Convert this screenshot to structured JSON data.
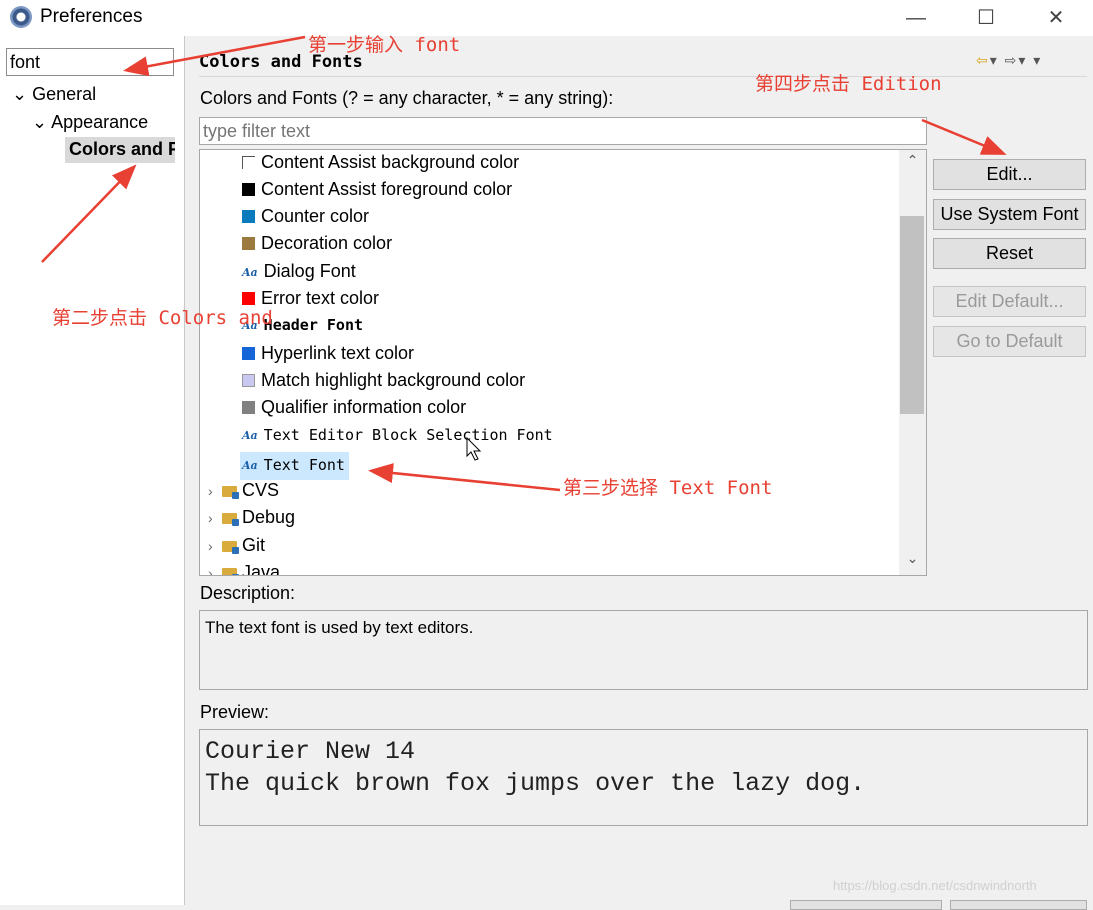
{
  "window": {
    "title": "Preferences",
    "controls": {
      "minimize": "—",
      "maximize": "☐",
      "close": "✕"
    }
  },
  "sidebar": {
    "filter_value": "font",
    "tree": {
      "general": "General",
      "appearance": "Appearance",
      "colors_and_fonts": "Colors and Fonts"
    }
  },
  "main": {
    "header": "Colors and Fonts",
    "list_label": "Colors and Fonts (? = any character, * = any string):",
    "filter_placeholder": "type filter text",
    "items": [
      {
        "label": "Content Assist background color",
        "icon": "swatch",
        "color": "#ffffff"
      },
      {
        "label": "Content Assist foreground color",
        "icon": "swatch",
        "color": "#000000"
      },
      {
        "label": "Counter color",
        "icon": "swatch",
        "color": "#0a7bbd"
      },
      {
        "label": "Decoration color",
        "icon": "swatch",
        "color": "#9c7a3f"
      },
      {
        "label": "Dialog Font",
        "icon": "font-icon"
      },
      {
        "label": "Error text color",
        "icon": "swatch",
        "color": "#ff0000"
      },
      {
        "label": "Header Font",
        "icon": "font-icon"
      },
      {
        "label": "Hyperlink text color",
        "icon": "swatch",
        "color": "#1565d8"
      },
      {
        "label": "Match highlight background color",
        "icon": "swatch",
        "color": "#c8c8f0"
      },
      {
        "label": "Qualifier information color",
        "icon": "swatch",
        "color": "#808080"
      },
      {
        "label": "Text Editor Block Selection Font",
        "icon": "font-icon"
      },
      {
        "label": "Text Font",
        "icon": "font-icon",
        "selected": true
      }
    ],
    "categories": [
      "CVS",
      "Debug",
      "Git",
      "Java"
    ],
    "buttons": {
      "edit": "Edit...",
      "use_system_font": "Use System Font",
      "reset": "Reset",
      "edit_default": "Edit Default...",
      "go_to_default": "Go to Default"
    },
    "description_label": "Description:",
    "description_text": "The text font is used by text editors.",
    "preview_label": "Preview:",
    "preview_text": "Courier New 14\nThe quick brown fox jumps over the lazy dog."
  },
  "annotations": {
    "step1": "第一步输入 font",
    "step2": "第二步点击 Colors and",
    "step3": "第三步选择 Text Font",
    "step4": "第四步点击 Edition"
  },
  "watermark": "https://blog.csdn.net/csdnwindnorth",
  "colors": {
    "annotation": "#e84033",
    "selection": "#cce8ff",
    "font_icon": "#1a5fa8"
  }
}
